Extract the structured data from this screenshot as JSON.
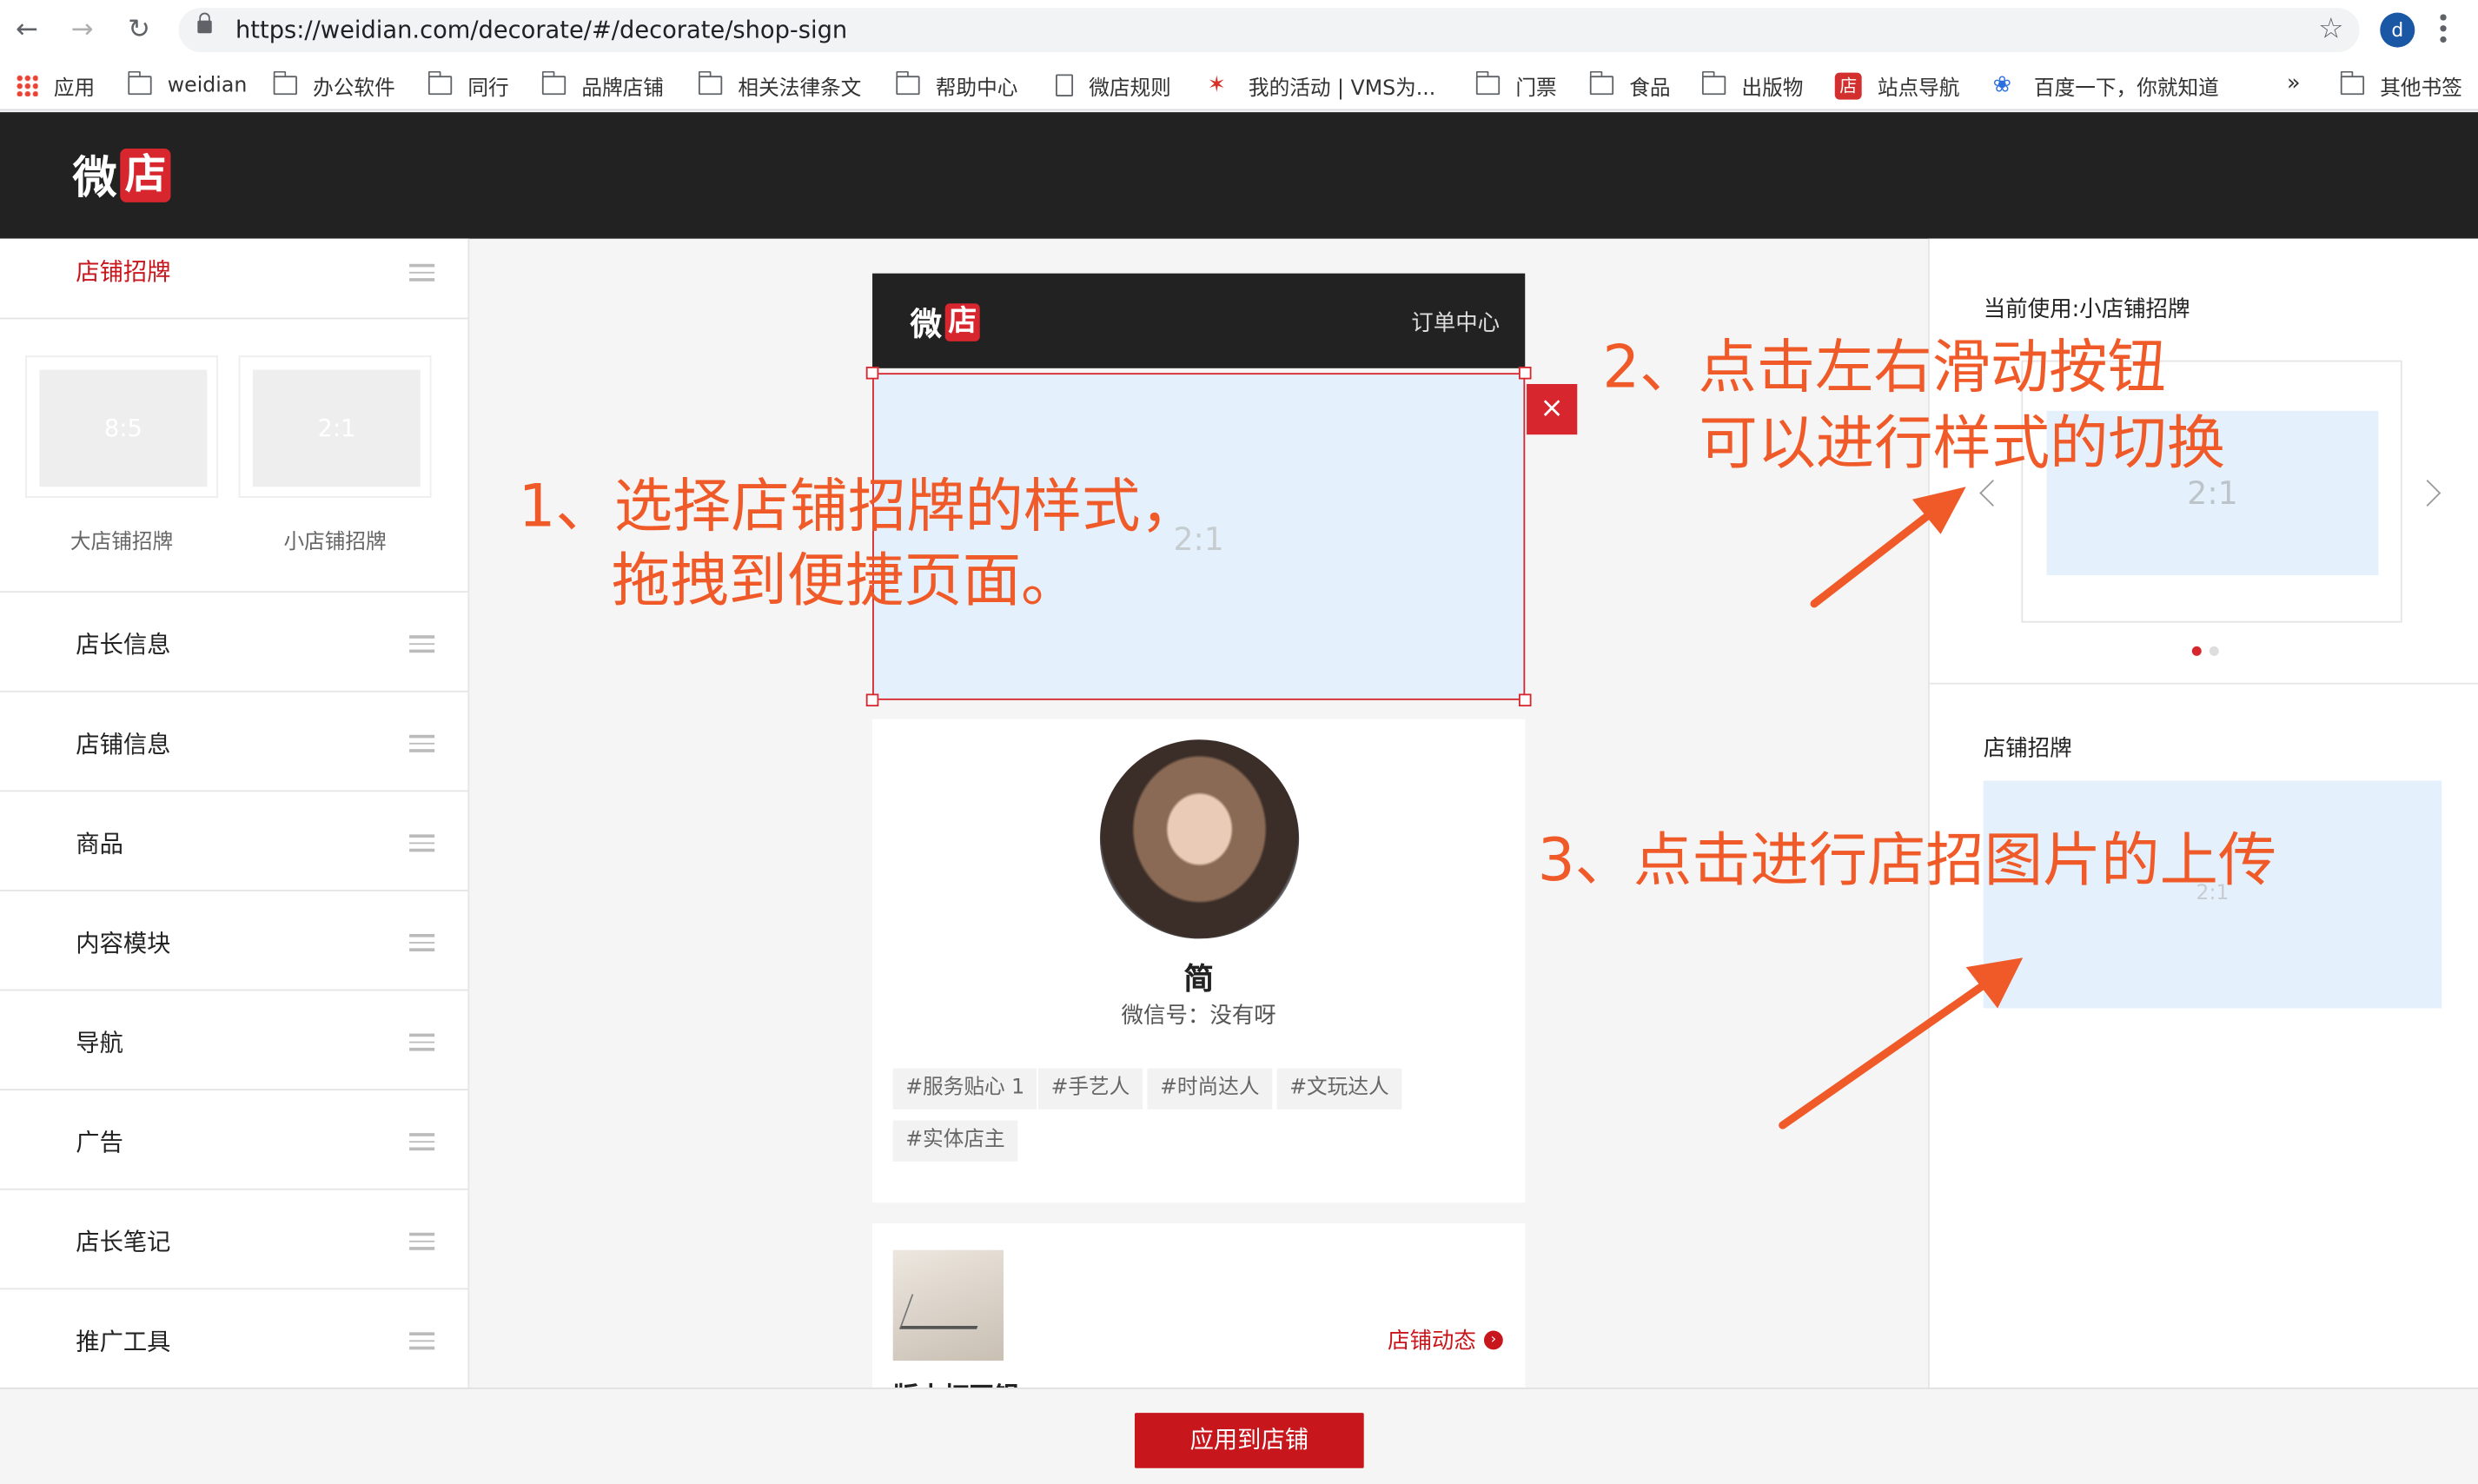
{
  "browser": {
    "url": "https://weidian.com/decorate/#/decorate/shop-sign",
    "avatar_letter": "d",
    "bookmarks_more": "»",
    "bookmarks": [
      "应用",
      "weidian",
      "办公软件",
      "同行",
      "品牌店铺",
      "相关法律条文",
      "帮助中心",
      "微店规则",
      "我的活动 | VMS为...",
      "门票",
      "食品",
      "出版物",
      "站点导航",
      "百度一下，你就知道"
    ],
    "other_bookmarks": "其他书签",
    "dian_badge": "店"
  },
  "header": {
    "logo_wei": "微",
    "logo_dian": "店"
  },
  "left_panel": {
    "shop_sign_title": "店铺招牌",
    "templates": [
      {
        "ratio": "8:5",
        "caption": "大店铺招牌"
      },
      {
        "ratio": "2:1",
        "caption": "小店铺招牌"
      }
    ],
    "menu": [
      "店长信息",
      "店铺信息",
      "商品",
      "内容模块",
      "导航",
      "广告",
      "店长笔记",
      "推广工具"
    ]
  },
  "preview": {
    "logo_wei": "微",
    "logo_dian": "店",
    "order_center": "订单中心",
    "sign_ratio": "2:1",
    "close": "×",
    "profile": {
      "name": "简",
      "wechat": "微信号：没有呀",
      "tags": [
        "#服务贴心 1",
        "#手艺人",
        "#时尚达人",
        "#文玩达人",
        "#实体店主"
      ]
    },
    "news": {
      "link": "店铺动态",
      "link_icon": "›",
      "title_partial": "版本打开铝"
    }
  },
  "right_panel": {
    "current_use": "当前使用:小店铺招牌",
    "carousel_ratio": "2:1",
    "carousel_active_dot": 1,
    "carousel_dots": 2,
    "upload_title": "店铺招牌",
    "upload_ratio": "2:1"
  },
  "footer": {
    "apply": "应用到店铺"
  },
  "annotations": {
    "step1_line1": "1、选择店铺招牌的样式，",
    "step1_line2": "拖拽到便捷页面。",
    "step2_line1": "2、点击左右滑动按钮",
    "step2_line2": "可以进行样式的切换",
    "step3": "3、点击进行店招图片的上传",
    "color": "#f05a28"
  },
  "colors": {
    "brand_red": "#d8262e",
    "dark_header": "#222222",
    "sign_fill": "#e4f1fc"
  }
}
